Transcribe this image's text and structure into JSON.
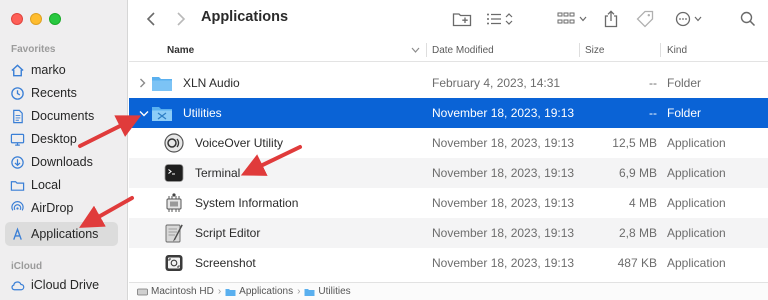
{
  "window": {
    "title": "Applications"
  },
  "sidebar": {
    "sections": [
      {
        "label": "Favorites",
        "items": [
          {
            "label": "marko",
            "icon": "home-icon"
          },
          {
            "label": "Recents",
            "icon": "clock-icon"
          },
          {
            "label": "Documents",
            "icon": "document-icon"
          },
          {
            "label": "Desktop",
            "icon": "desktop-icon"
          },
          {
            "label": "Downloads",
            "icon": "download-icon"
          },
          {
            "label": "Local",
            "icon": "folder-icon"
          },
          {
            "label": "AirDrop",
            "icon": "airdrop-icon"
          },
          {
            "label": "Applications",
            "icon": "applications-icon",
            "selected": true
          }
        ]
      },
      {
        "label": "iCloud",
        "items": [
          {
            "label": "iCloud Drive",
            "icon": "cloud-icon"
          }
        ]
      }
    ]
  },
  "columns": {
    "name": "Name",
    "date": "Date Modified",
    "size": "Size",
    "kind": "Kind"
  },
  "rows": [
    {
      "name": "XLN Audio",
      "date": "February 4, 2023, 14:31",
      "size": "--",
      "kind": "Folder",
      "icon": "folder-icon"
    },
    {
      "name": "Utilities",
      "date": "November 18, 2023, 19:13",
      "size": "--",
      "kind": "Folder",
      "icon": "utilities-folder-icon"
    },
    {
      "name": "VoiceOver Utility",
      "date": "November 18, 2023, 19:13",
      "size": "12,5 MB",
      "kind": "Application",
      "icon": "voiceover-icon"
    },
    {
      "name": "Terminal",
      "date": "November 18, 2023, 19:13",
      "size": "6,9 MB",
      "kind": "Application",
      "icon": "terminal-icon"
    },
    {
      "name": "System Information",
      "date": "November 18, 2023, 19:13",
      "size": "4 MB",
      "kind": "Application",
      "icon": "system-information-icon"
    },
    {
      "name": "Script Editor",
      "date": "November 18, 2023, 19:13",
      "size": "2,8 MB",
      "kind": "Application",
      "icon": "script-editor-icon"
    },
    {
      "name": "Screenshot",
      "date": "November 18, 2023, 19:13",
      "size": "487 KB",
      "kind": "Application",
      "icon": "screenshot-icon"
    }
  ],
  "pathbar": [
    "Macintosh HD",
    "Applications",
    "Utilities"
  ],
  "colors": {
    "selection": "#0a63d6",
    "annotation_arrow": "#e03b3b",
    "folder": "#5ab0ef"
  }
}
